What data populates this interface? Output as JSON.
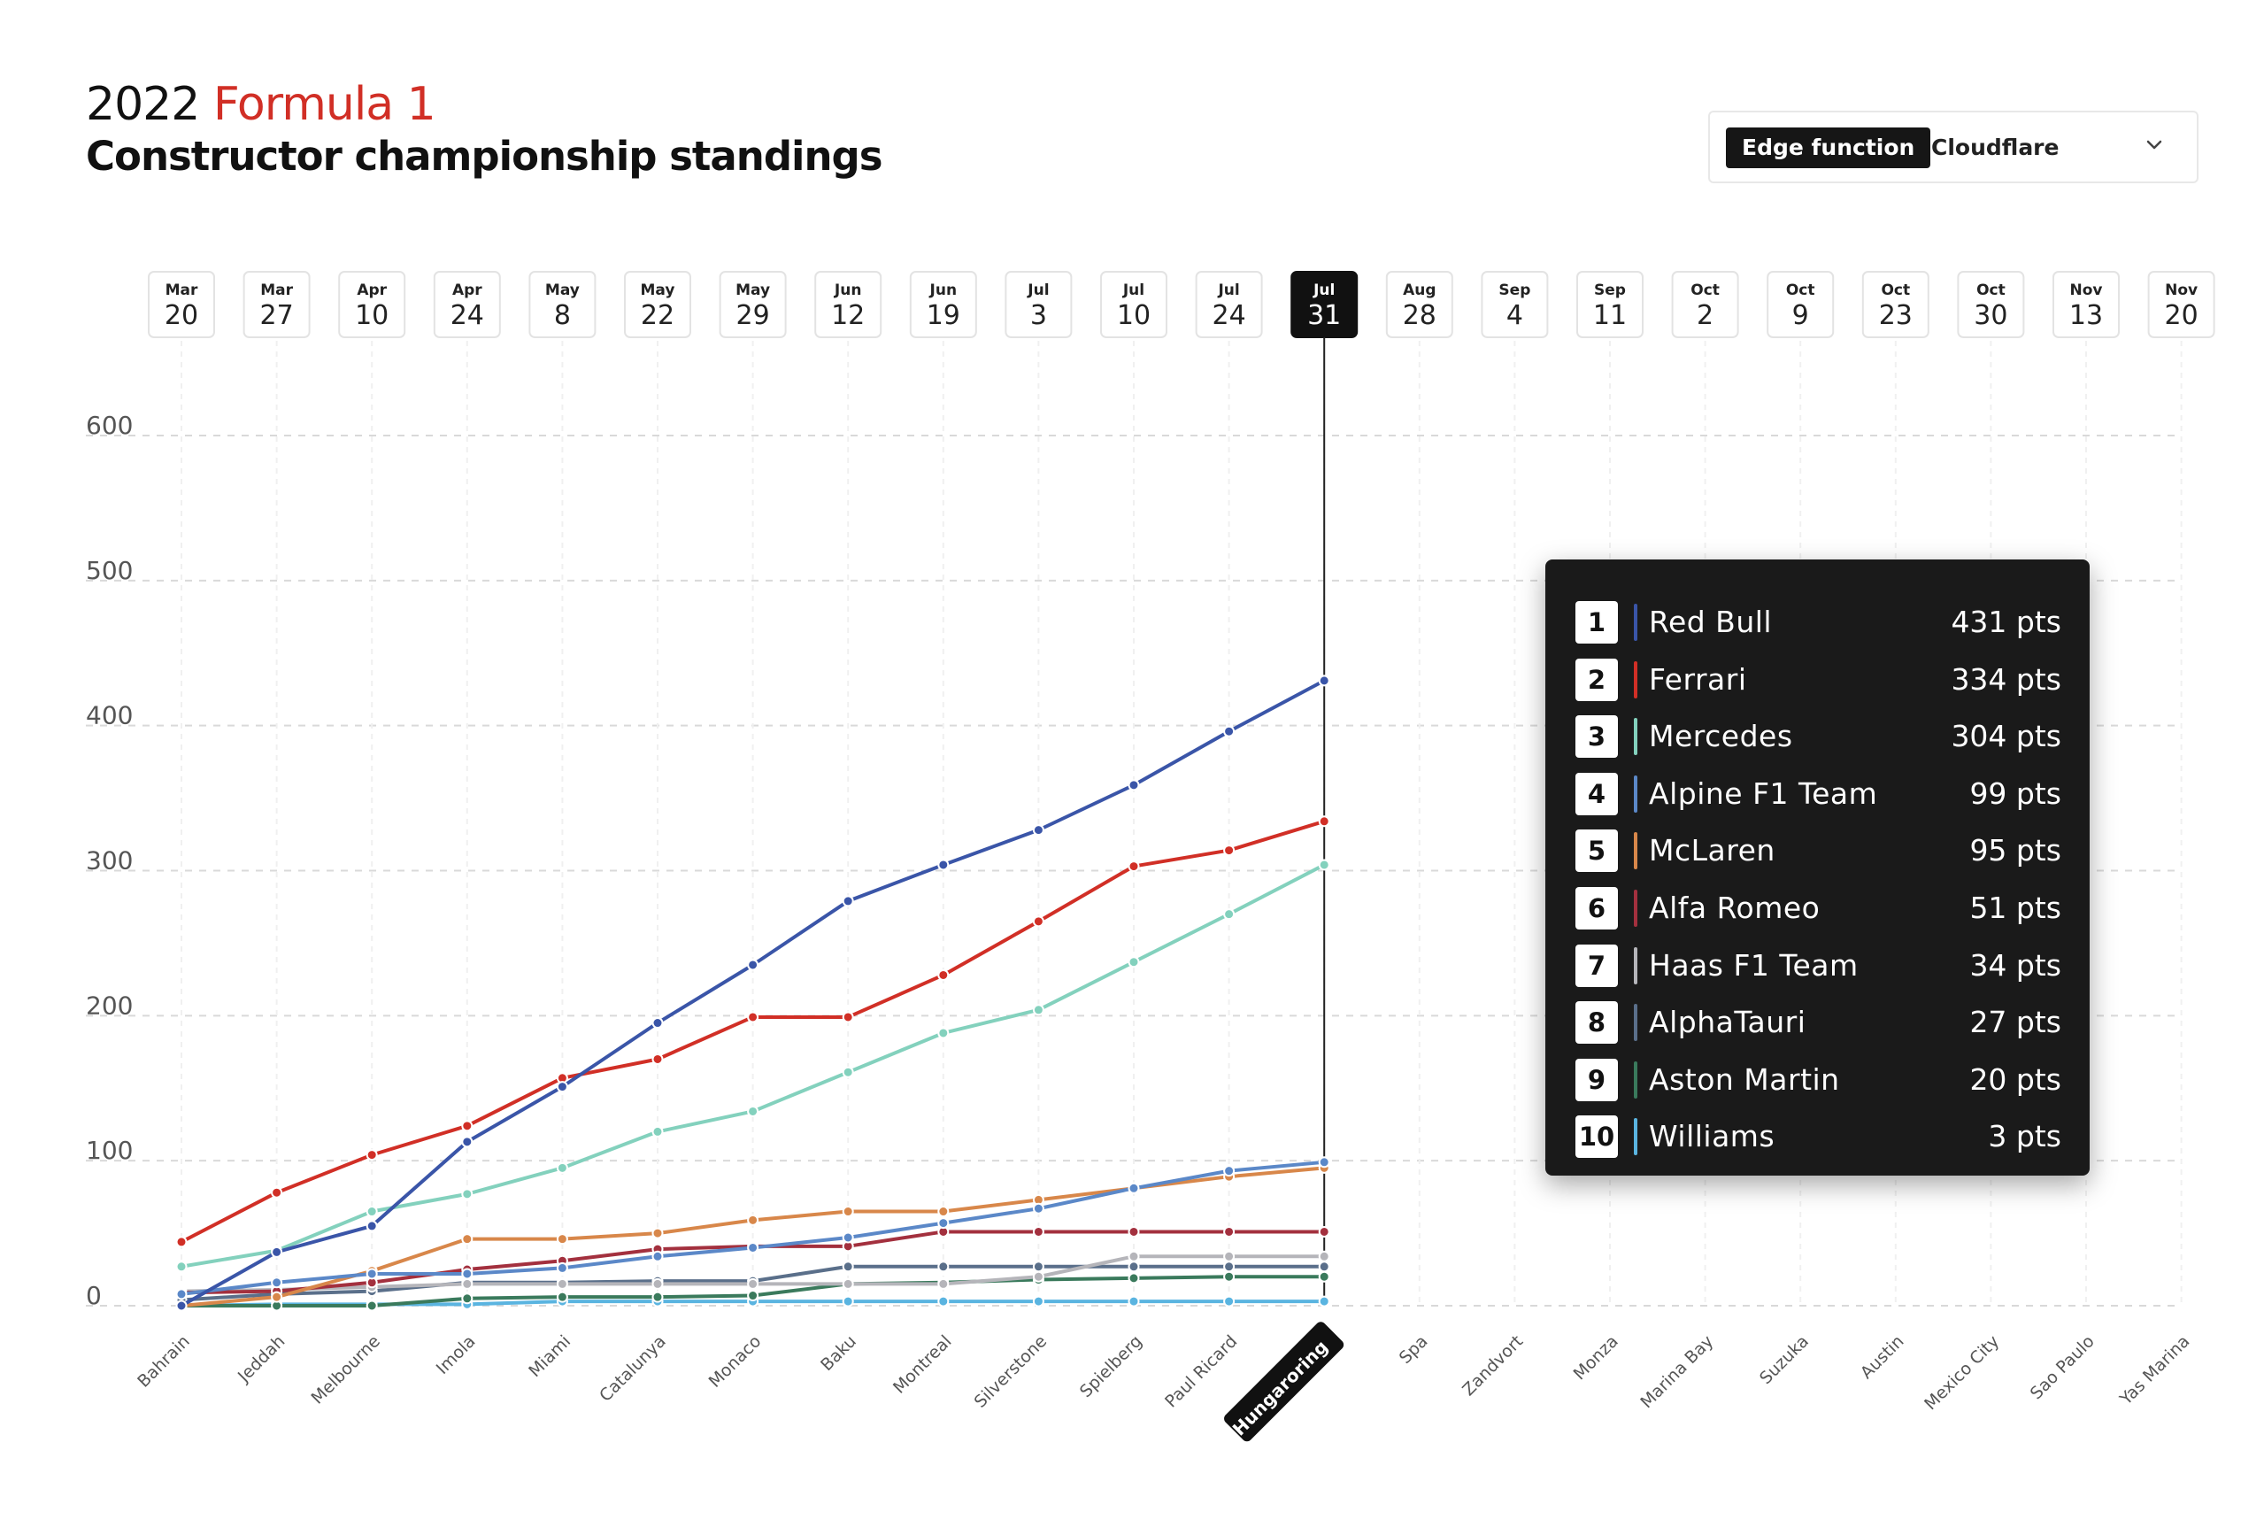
{
  "header": {
    "year": "2022",
    "series": "Formula 1",
    "subtitle": "Constructor championship standings"
  },
  "edge_selector": {
    "label": "Edge function",
    "value": "Cloudflare"
  },
  "colors": {
    "accent_red": "#d12f26",
    "panel_bg": "#1a1a1a",
    "active_date_bg": "#111111"
  },
  "chart_data": {
    "type": "line",
    "title": "Constructor championship standings",
    "ylim": [
      0,
      600
    ],
    "yticks": [
      0,
      100,
      200,
      300,
      400,
      500,
      600
    ],
    "grid": true,
    "active_index": 12,
    "dates": [
      {
        "month": "Mar",
        "day": "20"
      },
      {
        "month": "Mar",
        "day": "27"
      },
      {
        "month": "Apr",
        "day": "10"
      },
      {
        "month": "Apr",
        "day": "24"
      },
      {
        "month": "May",
        "day": "8"
      },
      {
        "month": "May",
        "day": "22"
      },
      {
        "month": "May",
        "day": "29"
      },
      {
        "month": "Jun",
        "day": "12"
      },
      {
        "month": "Jun",
        "day": "19"
      },
      {
        "month": "Jul",
        "day": "3"
      },
      {
        "month": "Jul",
        "day": "10"
      },
      {
        "month": "Jul",
        "day": "24"
      },
      {
        "month": "Jul",
        "day": "31"
      },
      {
        "month": "Aug",
        "day": "28"
      },
      {
        "month": "Sep",
        "day": "4"
      },
      {
        "month": "Sep",
        "day": "11"
      },
      {
        "month": "Oct",
        "day": "2"
      },
      {
        "month": "Oct",
        "day": "9"
      },
      {
        "month": "Oct",
        "day": "23"
      },
      {
        "month": "Oct",
        "day": "30"
      },
      {
        "month": "Nov",
        "day": "13"
      },
      {
        "month": "Nov",
        "day": "20"
      }
    ],
    "categories": [
      "Bahrain",
      "Jeddah",
      "Melbourne",
      "Imola",
      "Miami",
      "Catalunya",
      "Monaco",
      "Baku",
      "Montreal",
      "Silverstone",
      "Spielberg",
      "Paul Ricard",
      "Hungaroring",
      "Spa",
      "Zandvort",
      "Monza",
      "Marina Bay",
      "Suzuka",
      "Austin",
      "Mexico City",
      "Sao Paulo",
      "Yas Marina"
    ],
    "series": [
      {
        "name": "Red Bull",
        "color": "#3a55a8",
        "values": [
          0,
          37,
          55,
          113,
          151,
          195,
          235,
          279,
          304,
          328,
          359,
          396,
          431
        ]
      },
      {
        "name": "Ferrari",
        "color": "#d12f26",
        "values": [
          44,
          78,
          104,
          124,
          157,
          170,
          199,
          199,
          228,
          265,
          303,
          314,
          334
        ]
      },
      {
        "name": "Mercedes",
        "color": "#83d1bd",
        "values": [
          27,
          38,
          65,
          77,
          95,
          120,
          134,
          161,
          188,
          204,
          237,
          270,
          304
        ]
      },
      {
        "name": "Alpine F1 Team",
        "color": "#5b88c8",
        "values": [
          8,
          16,
          22,
          22,
          26,
          34,
          40,
          47,
          57,
          67,
          81,
          93,
          99
        ]
      },
      {
        "name": "McLaren",
        "color": "#d8874a",
        "values": [
          0,
          6,
          24,
          46,
          46,
          50,
          59,
          65,
          65,
          73,
          81,
          89,
          95
        ]
      },
      {
        "name": "Alfa Romeo",
        "color": "#a3303e",
        "values": [
          9,
          10,
          16,
          25,
          31,
          39,
          41,
          41,
          51,
          51,
          51,
          51,
          51
        ]
      },
      {
        "name": "Haas F1 Team",
        "color": "#b5b5ba",
        "values": [
          10,
          11,
          13,
          15,
          15,
          15,
          15,
          15,
          15,
          20,
          34,
          34,
          34
        ]
      },
      {
        "name": "AlphaTauri",
        "color": "#5a6f8a",
        "values": [
          4,
          8,
          10,
          16,
          16,
          17,
          17,
          27,
          27,
          27,
          27,
          27,
          27
        ]
      },
      {
        "name": "Aston Martin",
        "color": "#3a7a5c",
        "values": [
          0,
          0,
          0,
          5,
          6,
          6,
          7,
          15,
          16,
          18,
          19,
          20,
          20
        ]
      },
      {
        "name": "Williams",
        "color": "#5ab4e0",
        "values": [
          0,
          1,
          1,
          1,
          3,
          3,
          3,
          3,
          3,
          3,
          3,
          3,
          3
        ]
      }
    ]
  },
  "standings": [
    {
      "rank": "1",
      "team": "Red Bull",
      "pts": "431 pts",
      "color": "#3a55a8"
    },
    {
      "rank": "2",
      "team": "Ferrari",
      "pts": "334 pts",
      "color": "#d12f26"
    },
    {
      "rank": "3",
      "team": "Mercedes",
      "pts": "304 pts",
      "color": "#83d1bd"
    },
    {
      "rank": "4",
      "team": "Alpine F1 Team",
      "pts": "99 pts",
      "color": "#5b88c8"
    },
    {
      "rank": "5",
      "team": "McLaren",
      "pts": "95 pts",
      "color": "#d8874a"
    },
    {
      "rank": "6",
      "team": "Alfa Romeo",
      "pts": "51 pts",
      "color": "#a3303e"
    },
    {
      "rank": "7",
      "team": "Haas F1 Team",
      "pts": "34 pts",
      "color": "#b5b5ba"
    },
    {
      "rank": "8",
      "team": "AlphaTauri",
      "pts": "27 pts",
      "color": "#5a6f8a"
    },
    {
      "rank": "9",
      "team": "Aston Martin",
      "pts": "20 pts",
      "color": "#3a7a5c"
    },
    {
      "rank": "10",
      "team": "Williams",
      "pts": "3 pts",
      "color": "#5ab4e0"
    }
  ]
}
